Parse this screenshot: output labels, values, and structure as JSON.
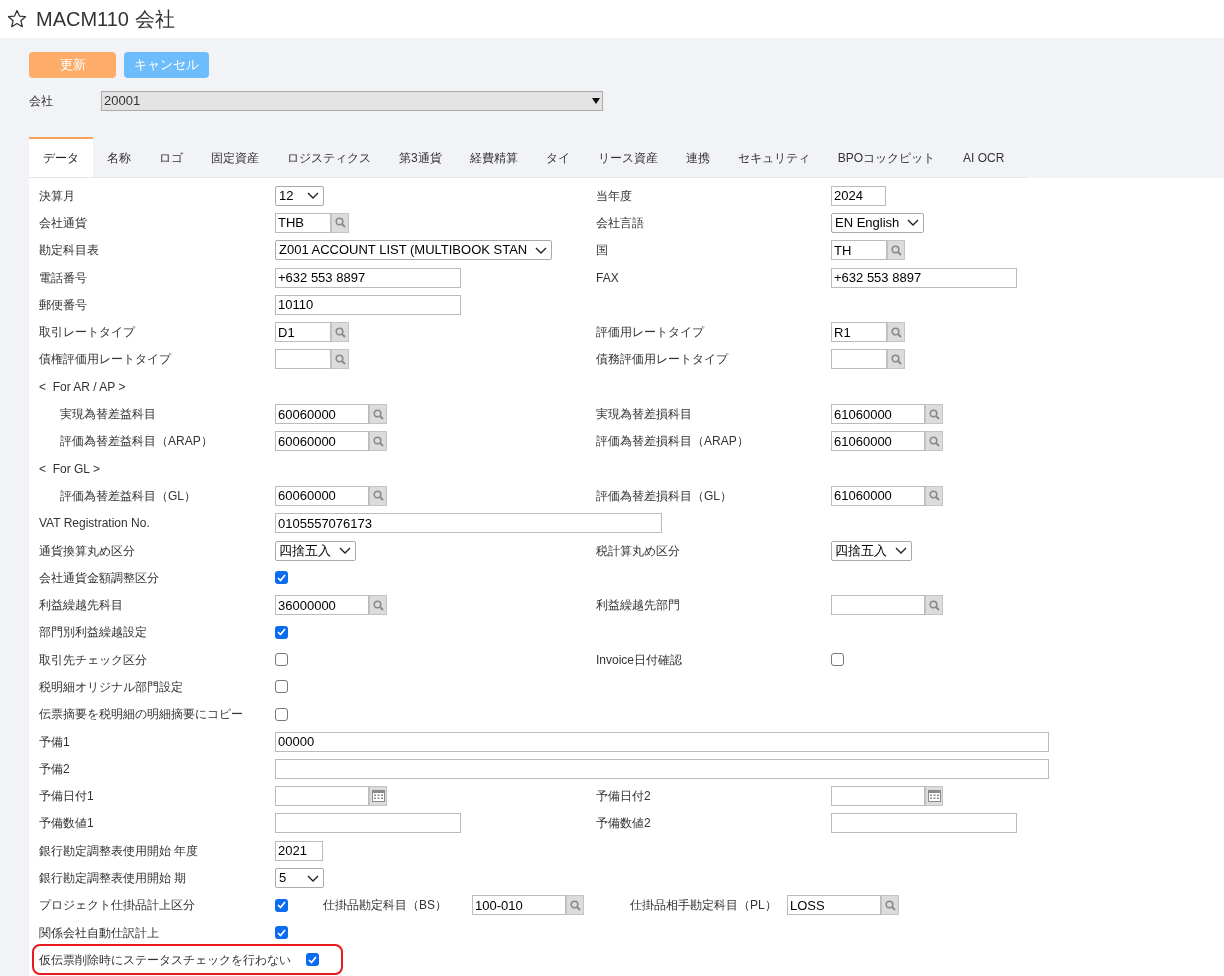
{
  "title": "MACM110 会社",
  "buttons": [
    {
      "kind": "primary",
      "label": "更新"
    },
    {
      "kind": "secondary",
      "label": "キャンセル"
    }
  ],
  "company": {
    "label": "会社",
    "value": "20001"
  },
  "tabs": [
    {
      "label": "データ",
      "selected": true
    },
    {
      "label": "名称",
      "selected": false
    },
    {
      "label": "ロゴ",
      "selected": false
    },
    {
      "label": "固定資産",
      "selected": false
    },
    {
      "label": "ロジスティクス",
      "selected": false
    },
    {
      "label": "第3通貨",
      "selected": false
    },
    {
      "label": "経費精算",
      "selected": false
    },
    {
      "label": "タイ",
      "selected": false
    },
    {
      "label": "リース資産",
      "selected": false
    },
    {
      "label": "連携",
      "selected": false
    },
    {
      "label": "セキュリティ",
      "selected": false
    },
    {
      "label": "BPOコックピット",
      "selected": false
    },
    {
      "label": "AI OCR",
      "selected": false
    }
  ],
  "rows": [
    {
      "highlighted": false,
      "left": {
        "label": "決算月",
        "field": {
          "kind": "select",
          "value": "12"
        }
      },
      "right": {
        "label": "当年度",
        "field": {
          "kind": "year",
          "value": "2024"
        }
      }
    },
    {
      "highlighted": false,
      "left": {
        "label": "会社通貨",
        "field": {
          "kind": "code-lookup",
          "value": "THB"
        }
      },
      "right": {
        "label": "会社言語",
        "field": {
          "kind": "select",
          "value": "EN English"
        }
      }
    },
    {
      "highlighted": false,
      "left": {
        "label": "勘定科目表",
        "field": {
          "kind": "select",
          "value": "Z001 ACCOUNT LIST (MULTIBOOK STAN"
        }
      },
      "right": {
        "label": "国",
        "field": {
          "kind": "code-lookup",
          "value": "TH"
        }
      }
    },
    {
      "highlighted": false,
      "left": {
        "label": "電話番号",
        "field": {
          "kind": "text",
          "value": "+632 553 8897"
        }
      },
      "right": {
        "label": "FAX",
        "field": {
          "kind": "text",
          "value": "+632 553 8897"
        }
      }
    },
    {
      "highlighted": false,
      "left": {
        "label": "郵便番号",
        "field": {
          "kind": "text",
          "value": "10110"
        }
      }
    },
    {
      "highlighted": false,
      "left": {
        "label": "取引レートタイプ",
        "field": {
          "kind": "code-lookup",
          "value": "D1"
        }
      },
      "right": {
        "label": "評価用レートタイプ",
        "field": {
          "kind": "code-lookup",
          "value": "R1"
        }
      }
    },
    {
      "highlighted": false,
      "left": {
        "label": "債権評価用レートタイプ",
        "field": {
          "kind": "code-lookup"
        }
      },
      "right": {
        "label": "債務評価用レートタイプ",
        "field": {
          "kind": "code-lookup"
        }
      }
    },
    {
      "kind": "section",
      "label": "<  For AR / AP >",
      "children": [
        {
          "highlighted": false,
          "left": {
            "label": "実現為替差益科目",
            "field": {
              "kind": "account-lookup",
              "value": "60060000"
            }
          },
          "right": {
            "label": "実現為替差損科目",
            "field": {
              "kind": "account-lookup",
              "value": "61060000"
            }
          }
        },
        {
          "highlighted": false,
          "left": {
            "label": "評価為替差益科目（ARAP）",
            "field": {
              "kind": "account-lookup",
              "value": "60060000"
            }
          },
          "right": {
            "label": "評価為替差損科目（ARAP）",
            "field": {
              "kind": "account-lookup",
              "value": "61060000"
            }
          }
        }
      ]
    },
    {
      "kind": "section",
      "label": "<  For GL >",
      "children": [
        {
          "highlighted": false,
          "left": {
            "label": "評価為替差益科目（GL）",
            "field": {
              "kind": "account-lookup",
              "value": "60060000"
            }
          },
          "right": {
            "label": "評価為替差損科目（GL）",
            "field": {
              "kind": "account-lookup",
              "value": "61060000"
            }
          }
        }
      ]
    },
    {
      "highlighted": false,
      "left": {
        "label": "VAT Registration No.",
        "field": {
          "kind": "long-text",
          "value": "0105557076173"
        }
      }
    },
    {
      "highlighted": false,
      "left": {
        "label": "通貨換算丸め区分",
        "field": {
          "kind": "select",
          "value": "四捨五入"
        }
      },
      "right": {
        "label": "税計算丸め区分",
        "field": {
          "kind": "select",
          "value": "四捨五入"
        }
      }
    },
    {
      "highlighted": false,
      "left": {
        "label": "会社通貨金額調整区分",
        "field": {
          "kind": "checkbox",
          "checked": true
        }
      }
    },
    {
      "highlighted": false,
      "left": {
        "label": "利益繰越先科目",
        "field": {
          "kind": "account-lookup",
          "value": "36000000"
        }
      },
      "right": {
        "label": "利益繰越先部門",
        "field": {
          "kind": "account-lookup"
        }
      }
    },
    {
      "highlighted": false,
      "left": {
        "label": "部門別利益繰越設定",
        "field": {
          "kind": "checkbox",
          "checked": true
        }
      }
    },
    {
      "highlighted": false,
      "left": {
        "label": "取引先チェック区分",
        "field": {
          "kind": "checkbox",
          "checked": false
        }
      },
      "right": {
        "label": "Invoice日付確認",
        "field": {
          "kind": "checkbox",
          "checked": false
        }
      }
    },
    {
      "highlighted": false,
      "left": {
        "label": "税明細オリジナル部門設定",
        "field": {
          "kind": "checkbox",
          "checked": false
        }
      }
    },
    {
      "highlighted": false,
      "left": {
        "label": "伝票摘要を税明細の明細摘要にコピー",
        "field": {
          "kind": "checkbox",
          "checked": false
        }
      }
    },
    {
      "highlighted": false,
      "left": {
        "label": "予備1",
        "field": {
          "kind": "memo-text",
          "value": "00000"
        }
      }
    },
    {
      "highlighted": false,
      "left": {
        "label": "予備2",
        "field": {
          "kind": "memo-text"
        }
      }
    },
    {
      "highlighted": false,
      "left": {
        "label": "予備日付1",
        "field": {
          "kind": "date"
        }
      },
      "right": {
        "label": "予備日付2",
        "field": {
          "kind": "date"
        }
      }
    },
    {
      "highlighted": false,
      "left": {
        "label": "予備数値1",
        "field": {
          "kind": "text"
        }
      },
      "right": {
        "label": "予備数値2",
        "field": {
          "kind": "text"
        }
      }
    },
    {
      "highlighted": false,
      "left": {
        "label": "銀行勘定調整表使用開始 年度",
        "field": {
          "kind": "short-year",
          "value": "2021"
        }
      }
    },
    {
      "highlighted": false,
      "left": {
        "label": "銀行勘定調整表使用開始 期",
        "field": {
          "kind": "select",
          "value": "5"
        }
      }
    },
    {
      "highlighted": false,
      "left": {
        "label": "プロジェクト仕掛品計上区分",
        "field": {
          "kind": "checkbox",
          "checked": true
        }
      },
      "extras": [
        {
          "label": "仕掛品勘定科目（BS）",
          "field": {
            "kind": "account-lookup",
            "value": "100-010"
          }
        },
        {
          "label": "仕掛品相手勘定科目（PL）",
          "field": {
            "kind": "account-lookup",
            "value": "LOSS"
          }
        }
      ]
    },
    {
      "highlighted": false,
      "left": {
        "label": "関係会社自動仕訳計上",
        "field": {
          "kind": "checkbox",
          "checked": true
        }
      }
    },
    {
      "highlighted": true,
      "left": {
        "label": "仮伝票削除時にステータスチェックを行わない",
        "field": {
          "kind": "checkbox",
          "checked": true
        }
      }
    }
  ]
}
